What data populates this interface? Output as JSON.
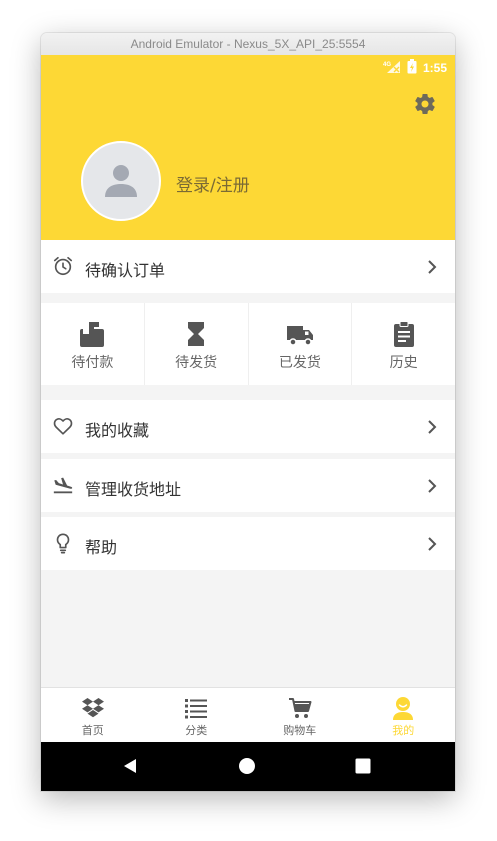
{
  "window": {
    "title": "Android Emulator - Nexus_5X_API_25:5554"
  },
  "status_bar": {
    "network": "4G",
    "time": "1:55"
  },
  "header": {
    "login_label": "登录/注册",
    "background": "#fdd835"
  },
  "pending": {
    "label": "待确认订单"
  },
  "orders": [
    {
      "label": "待付款",
      "icon": "wallet-icon"
    },
    {
      "label": "待发货",
      "icon": "hourglass-icon"
    },
    {
      "label": "已发货",
      "icon": "truck-icon"
    },
    {
      "label": "历史",
      "icon": "clipboard-icon"
    }
  ],
  "menu": [
    {
      "label": "我的收藏",
      "icon": "heart-icon"
    },
    {
      "label": "管理收货地址",
      "icon": "flight-land-icon"
    },
    {
      "label": "帮助",
      "icon": "lightbulb-icon"
    }
  ],
  "tabs": [
    {
      "label": "首页",
      "icon": "dropbox-icon"
    },
    {
      "label": "分类",
      "icon": "list-icon"
    },
    {
      "label": "购物车",
      "icon": "cart-icon"
    },
    {
      "label": "我的",
      "icon": "user-icon",
      "active": true
    }
  ],
  "accent_color": "#fdd835"
}
